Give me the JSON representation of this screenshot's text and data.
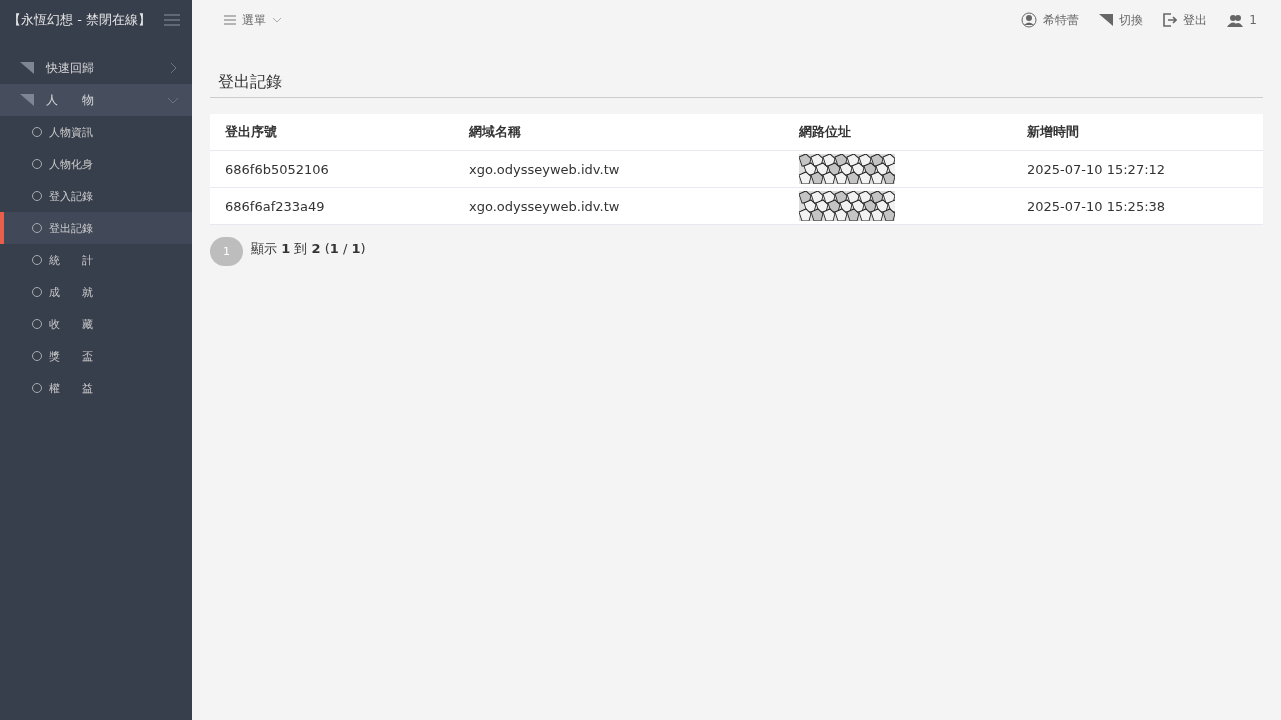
{
  "sidebar": {
    "title": "【永恆幻想 - 禁閉在線】",
    "items": [
      {
        "label": "快速回歸",
        "expanded": false,
        "selected": false
      },
      {
        "label": "人　　物",
        "expanded": true,
        "selected": true,
        "children": [
          {
            "label": "人物資訊",
            "selected": false
          },
          {
            "label": "人物化身",
            "selected": false
          },
          {
            "label": "登入記錄",
            "selected": false
          },
          {
            "label": "登出記錄",
            "selected": true
          },
          {
            "label": "統　　計",
            "selected": false
          },
          {
            "label": "成　　就",
            "selected": false
          },
          {
            "label": "收　　藏",
            "selected": false
          },
          {
            "label": "獎　　盃",
            "selected": false
          },
          {
            "label": "權　　益",
            "selected": false
          }
        ]
      }
    ]
  },
  "topbar": {
    "menu": "選單",
    "user": "希特蕾",
    "switch": "切換",
    "logout": "登出",
    "online": "1"
  },
  "page": {
    "title": "登出記錄"
  },
  "table": {
    "columns": [
      "登出序號",
      "網域名稱",
      "網路位址",
      "新增時間"
    ],
    "rows": [
      {
        "id": "686f6b5052106",
        "domain": "xgo.odysseyweb.idv.tw",
        "time": "2025-07-10 15:27:12"
      },
      {
        "id": "686f6af233a49",
        "domain": "xgo.odysseyweb.idv.tw",
        "time": "2025-07-10 15:25:38"
      }
    ]
  },
  "pagination": {
    "pages": [
      {
        "label": "1",
        "selected": true
      }
    ],
    "summary": "顯示 **1** 到 **2** (**1** / **1**)"
  }
}
